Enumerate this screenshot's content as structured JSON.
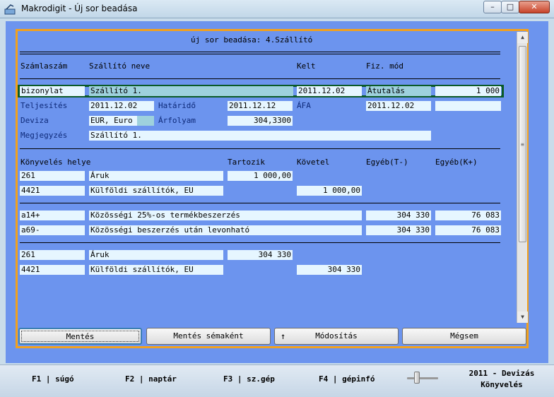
{
  "window": {
    "title": "Makrodigit - Új sor beadása",
    "min": "–",
    "max": "□",
    "close": "✕"
  },
  "panel": {
    "title": "új sor beadása: 4.Szállító"
  },
  "header": {
    "szamlaszam": "Számlaszám",
    "szallito_neve": "Szállító neve",
    "kelt": "Kelt",
    "fiz_mod": "Fiz. mód"
  },
  "row1": {
    "bizonylat": "bizonylat",
    "szallito": "Szállító 1.",
    "kelt": "2011.12.02",
    "fizmod": "Átutalás",
    "osszeg": "1 000"
  },
  "row2": {
    "teljesites_label": "Teljesítés",
    "teljesites": "2011.12.02",
    "hatarido_label": "Határidő",
    "hatarido": "2011.12.12",
    "afa_label": "ÁFA",
    "afa": "2011.12.02",
    "extra": ""
  },
  "row3": {
    "deviza_label": "Deviza",
    "deviza": "EUR, Euro",
    "arfolyam_label": "Árfolyam",
    "arfolyam": "304,3300"
  },
  "row4": {
    "megjegyzes_label": "Megjegyzés",
    "megjegyzes": "Szállító 1."
  },
  "kony_header": {
    "helye": "Könyvelés helye",
    "tartozik": "Tartozik",
    "kovetel": "Követel",
    "egyeb_t": "Egyéb(T-)",
    "egyeb_k": "Egyéb(K+)"
  },
  "kony": [
    {
      "account": "261",
      "name": "Áruk",
      "tartozik": "1 000,00",
      "kovetel": ""
    },
    {
      "account": "4421",
      "name": "Külföldi szállítók, EU",
      "tartozik": "",
      "kovetel": "1 000,00"
    }
  ],
  "afa_rows": [
    {
      "code": "a14+",
      "desc": "Közösségi 25%-os termékbeszerzés",
      "t": "304 330",
      "k": "76 083"
    },
    {
      "code": "a69-",
      "desc": "Közösségi beszerzés után levonható",
      "t": "304 330",
      "k": "76 083"
    }
  ],
  "ft_rows": [
    {
      "account": "261",
      "name": "Áruk",
      "tartozik": "304 330",
      "kovetel": ""
    },
    {
      "account": "4421",
      "name": "Külföldi szállítók, EU",
      "tartozik": "",
      "kovetel": "304 330"
    }
  ],
  "buttons": {
    "mentes": "Mentés",
    "mentes_sema": "Mentés sémaként",
    "modositas": "Módosítás",
    "modositas_arrow": "↑",
    "megsem": "Mégsem"
  },
  "statusbar": {
    "f1": "F1 | súgó",
    "f2": "F2 | naptár",
    "f3": "F3 | sz.gép",
    "f4": "F4 | gépinfó",
    "brand_line1": "2011 - Devizás",
    "brand_line2": "Könyvelés"
  }
}
